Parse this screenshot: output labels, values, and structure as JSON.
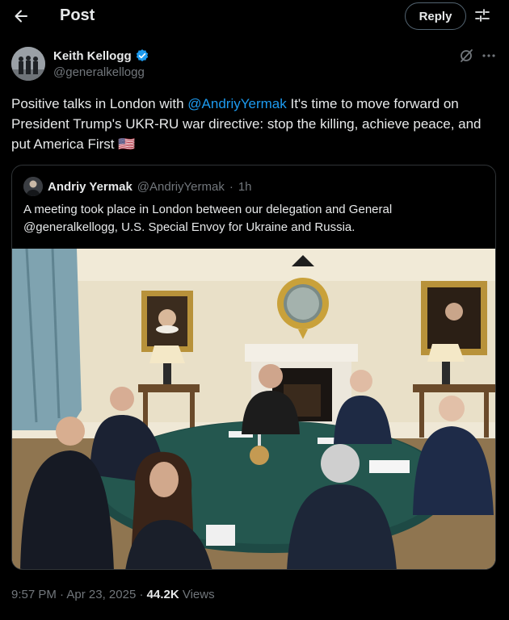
{
  "header": {
    "title": "Post",
    "reply_label": "Reply"
  },
  "author": {
    "name": "Keith Kellogg",
    "handle": "@generalkellogg"
  },
  "tweet": {
    "text_before": "Positive talks in London with ",
    "mention": "@AndriyYermak",
    "text_after": " It's time to move forward on President Trump's UKR-RU war directive: stop the killing, achieve peace, and put America First 🇺🇸"
  },
  "quote": {
    "name": "Andriy Yermak",
    "handle": "@AndriyYermak",
    "separator": "·",
    "time": "1h",
    "text": "A meeting took place in London between our delegation and General @generalkellogg, U.S. Special Envoy for Ukraine and Russia."
  },
  "meta": {
    "time": "9:57 PM",
    "date": "Apr 23, 2025",
    "separator": "·",
    "views_count": "44.2K",
    "views_label": "Views"
  },
  "icons": {
    "back": "arrow-left-icon",
    "settings": "sliders-icon",
    "verified": "verified-badge-icon",
    "grok": "grok-icon",
    "more": "more-dots-icon"
  },
  "colors": {
    "accent": "#1d9bf0",
    "background": "#000000",
    "muted": "#71767b",
    "border": "#2f3336"
  }
}
